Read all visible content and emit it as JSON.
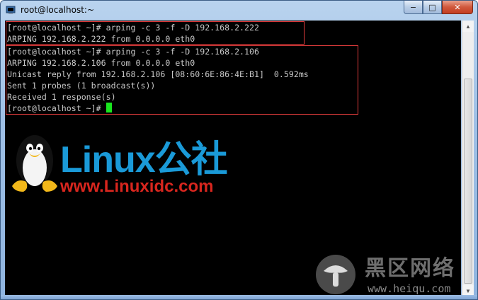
{
  "window": {
    "title": "root@localhost:~",
    "controls": {
      "minimize": "−",
      "maximize": "□",
      "close": "✕"
    }
  },
  "terminal": {
    "lines": [
      "[root@localhost ~]# arping -c 3 -f -D 192.168.2.222",
      "ARPING 192.168.2.222 from 0.0.0.0 eth0",
      "[root@localhost ~]# arping -c 3 -f -D 192.168.2.106",
      "ARPING 192.168.2.106 from 0.0.0.0 eth0",
      "Unicast reply from 192.168.2.106 [08:60:6E:86:4E:B1]  0.592ms",
      "Sent 1 probes (1 broadcast(s))",
      "Received 1 response(s)",
      "[root@localhost ~]# "
    ]
  },
  "watermarks": {
    "linux_brand": "Linux公社",
    "linux_url": "www.Linuxidc.com",
    "heiqu_brand": "黑区网络",
    "heiqu_url": "www.heiqu.com"
  },
  "colors": {
    "terminal_bg": "#000000",
    "terminal_text": "#c8c8c8",
    "cursor": "#19e61e",
    "highlight_box": "#e23c3c",
    "linux_blue": "#1a9ad8",
    "linux_red": "#d8261e"
  },
  "icons": {
    "app": "putty-terminal-icon",
    "scroll_up": "arrow-up-icon",
    "scroll_down": "arrow-down-icon"
  }
}
